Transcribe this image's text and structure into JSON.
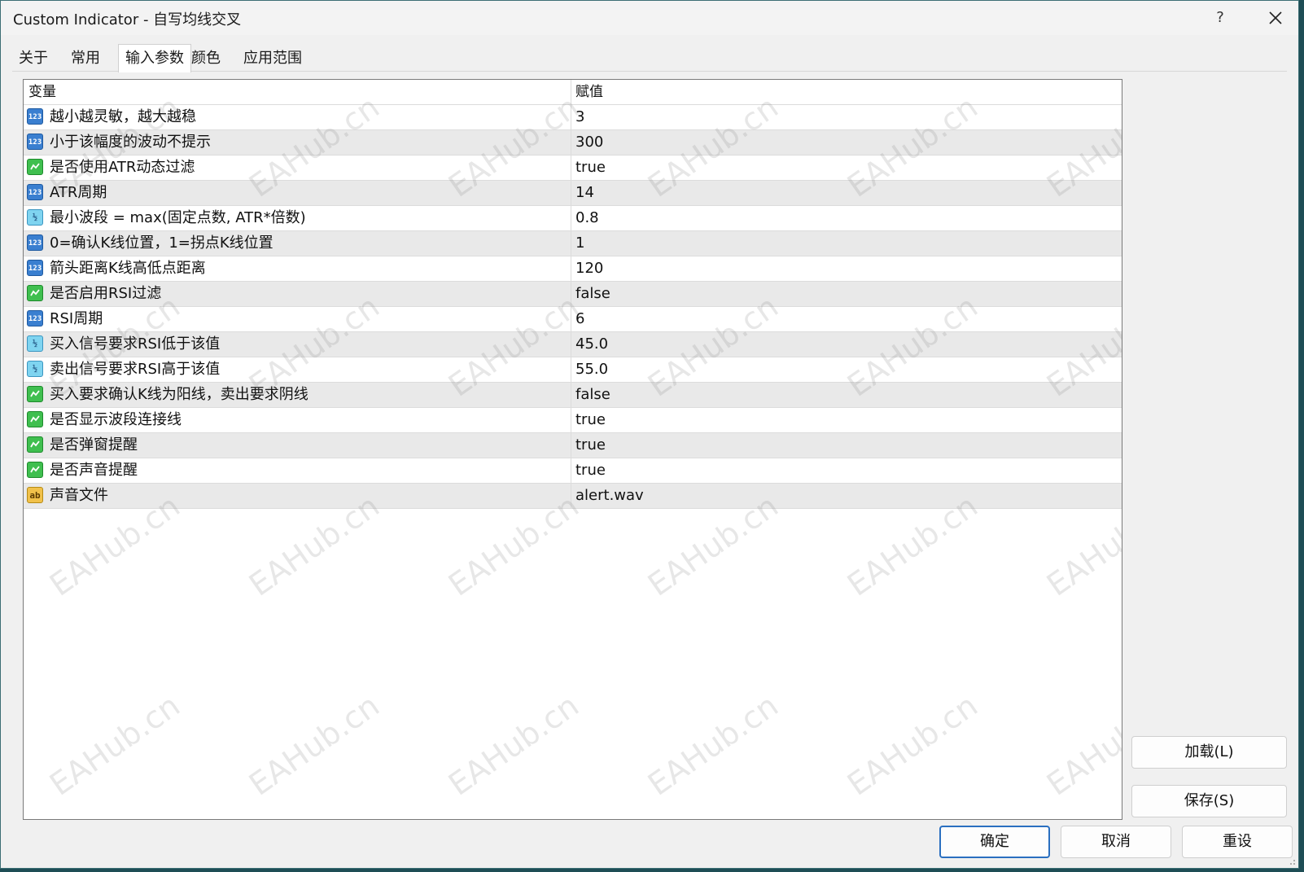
{
  "window": {
    "title": "Custom Indicator - 自写均线交叉",
    "help_label": "?"
  },
  "tabs": [
    {
      "label": "关于"
    },
    {
      "label": "常用"
    },
    {
      "label": "输入参数"
    },
    {
      "label": "颜色"
    },
    {
      "label": "应用范围"
    }
  ],
  "grid": {
    "header": {
      "variable": "变量",
      "value": "赋值"
    },
    "rows": [
      {
        "name": "越小越灵敏，越大越稳",
        "value": "3",
        "type": "int",
        "icon": "integer-icon"
      },
      {
        "name": "小于该幅度的波动不提示",
        "value": "300",
        "type": "int",
        "icon": "integer-icon"
      },
      {
        "name": "是否使用ATR动态过滤",
        "value": "true",
        "type": "bool",
        "icon": "boolean-icon"
      },
      {
        "name": "ATR周期",
        "value": "14",
        "type": "int",
        "icon": "integer-icon"
      },
      {
        "name": "最小波段 = max(固定点数, ATR*倍数)",
        "value": "0.8",
        "type": "double",
        "icon": "double-icon"
      },
      {
        "name": "0=确认K线位置，1=拐点K线位置",
        "value": "1",
        "type": "int",
        "icon": "integer-icon"
      },
      {
        "name": "箭头距离K线高低点距离",
        "value": "120",
        "type": "int",
        "icon": "integer-icon"
      },
      {
        "name": "是否启用RSI过滤",
        "value": "false",
        "type": "bool",
        "icon": "boolean-icon"
      },
      {
        "name": "RSI周期",
        "value": "6",
        "type": "int",
        "icon": "integer-icon"
      },
      {
        "name": "买入信号要求RSI低于该值",
        "value": "45.0",
        "type": "double",
        "icon": "double-icon"
      },
      {
        "name": "卖出信号要求RSI高于该值",
        "value": "55.0",
        "type": "double",
        "icon": "double-icon"
      },
      {
        "name": "买入要求确认K线为阳线，卖出要求阴线",
        "value": "false",
        "type": "bool",
        "icon": "boolean-icon"
      },
      {
        "name": "是否显示波段连接线",
        "value": "true",
        "type": "bool",
        "icon": "boolean-icon"
      },
      {
        "name": "是否弹窗提醒",
        "value": "true",
        "type": "bool",
        "icon": "boolean-icon"
      },
      {
        "name": "是否声音提醒",
        "value": "true",
        "type": "bool",
        "icon": "boolean-icon"
      },
      {
        "name": "声音文件",
        "value": "alert.wav",
        "type": "string",
        "icon": "string-icon"
      }
    ]
  },
  "icon_glyphs": {
    "int": "123",
    "double": "½",
    "string": "ab"
  },
  "side_buttons": {
    "load": "加载(L)",
    "save": "保存(S)"
  },
  "footer_buttons": {
    "ok": "确定",
    "cancel": "取消",
    "reset": "重设"
  },
  "watermark": "EAHub.cn",
  "colors": {
    "primary_border": "#2a6fc0",
    "bool_icon": "#3fbf4f",
    "int_icon": "#3a7fd0",
    "double_icon": "#7fd4f0",
    "string_icon": "#f1c14a"
  }
}
